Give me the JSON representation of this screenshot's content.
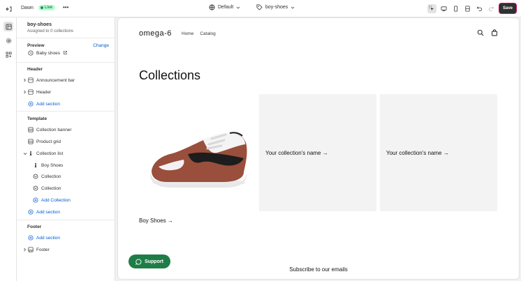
{
  "topbar": {
    "theme_name": "Dawn",
    "live_badge": "Live",
    "more": "•••",
    "template_select": "Default",
    "page_select": "boy-shoes",
    "save_label": "Save"
  },
  "sidebar": {
    "title": "boy-shoes",
    "subtitle": "Assigned to 0 collections",
    "preview_heading": "Preview",
    "change_link": "Change",
    "preview_item": "Baby shoes",
    "header_group": "Header",
    "header_items": [
      "Announcement bar",
      "Header"
    ],
    "add_section": "Add section",
    "template_group": "Template",
    "template_items": [
      "Collection banner",
      "Product grid",
      "Collection list"
    ],
    "collection_list_children": [
      "Boy Shoes",
      "Collection",
      "Collection"
    ],
    "add_collection": "Add Collection",
    "footer_group": "Footer",
    "footer_items": [
      "Footer"
    ]
  },
  "store": {
    "logo": "omega-6",
    "nav": [
      "Home",
      "Catalog"
    ],
    "collections_title": "Collections",
    "cards": [
      "Boy Shoes",
      "Your collection's name",
      "Your collection's name"
    ],
    "support_label": "Support",
    "subscribe_text": "Subscribe to our emails"
  },
  "colors": {
    "accent": "#005bd3",
    "live_bg": "#b4fed2",
    "support_bg": "#1e7d46",
    "save_border": "#c0146e"
  }
}
